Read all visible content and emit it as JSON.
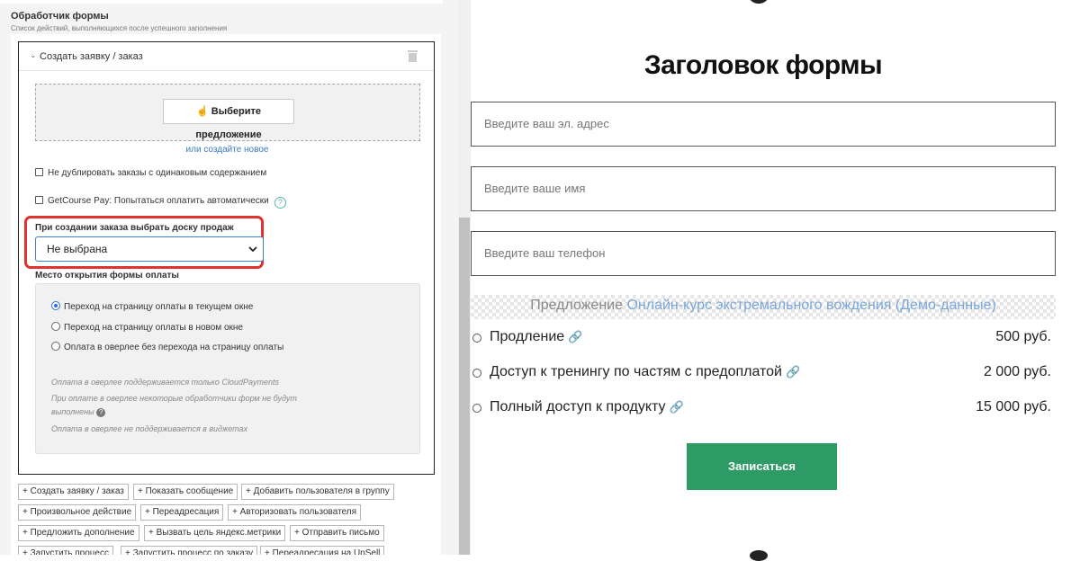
{
  "left_panel": {
    "section_title": "Обработчик формы",
    "section_desc": "Список действий, выполняющихся после успешного заполнения",
    "handler": {
      "title": "Создать заявку / заказ",
      "select_offer_label": "Выберите предложение",
      "create_new_link": "или создайте новое",
      "no_duplicate_label": "Не дублировать заказы с одинаковым содержанием",
      "getcourse_pay_label": "GetCourse Pay: Попытаться оплатить автоматически",
      "help_glyph": "?",
      "sales_board_label": "При создании заказа выбрать доску продаж",
      "sales_board_value": "Не выбрана",
      "payment_place_label": "Место открытия формы оплаты",
      "payment_options": [
        {
          "label": "Переход на страницу оплаты в текущем окне",
          "selected": true
        },
        {
          "label": "Переход на страницу оплаты в новом окне",
          "selected": false
        },
        {
          "label": "Оплата в оверлее без перехода на страницу оплаты",
          "selected": false
        }
      ],
      "notes": [
        "Оплата в оверлее поддерживается только CloudPayments",
        "При оплате в оверлее некоторые обработчики форм не будут выполнены",
        "Оплата в оверлее не поддерживается в виджетах"
      ]
    },
    "actions": [
      "+ Создать заявку / заказ",
      "+ Показать сообщение",
      "+ Добавить пользователя в группу",
      "+ Произвольное действие",
      "+ Переадресация",
      "+ Авторизовать пользователя",
      "+ Предложить дополнение",
      "+ Вызвать цель яндекс.метрики",
      "+ Отправить письмо",
      "+ Запустить процесс",
      "+ Запустить процесс по заказу",
      "+ Переадресация на UpSell"
    ]
  },
  "form": {
    "title": "Заголовок формы",
    "email_placeholder": "Введите ваш эл. адрес",
    "name_placeholder": "Введите ваше имя",
    "phone_placeholder": "Введите ваш телефон",
    "offer_prefix": "Предложение",
    "offer_name": "Онлайн-курс экстремального вождения (Демо-данные)",
    "products": [
      {
        "name": "Продление",
        "price": "500 руб."
      },
      {
        "name": "Доступ к тренингу по частям с предоплатой",
        "price": "2 000 руб."
      },
      {
        "name": "Полный доступ к продукту",
        "price": "15 000 руб."
      }
    ],
    "submit_label": "Записаться"
  },
  "colors": {
    "accent_blue": "#3d7fd1",
    "highlight_red": "#e0322f",
    "submit_green": "#2e9a66",
    "help_teal": "#5bb7a9"
  },
  "icons": [
    "chevron-down-icon",
    "trash-icon",
    "pointer-hand-icon",
    "help-icon",
    "select-arrow-icon",
    "link-icon"
  ]
}
